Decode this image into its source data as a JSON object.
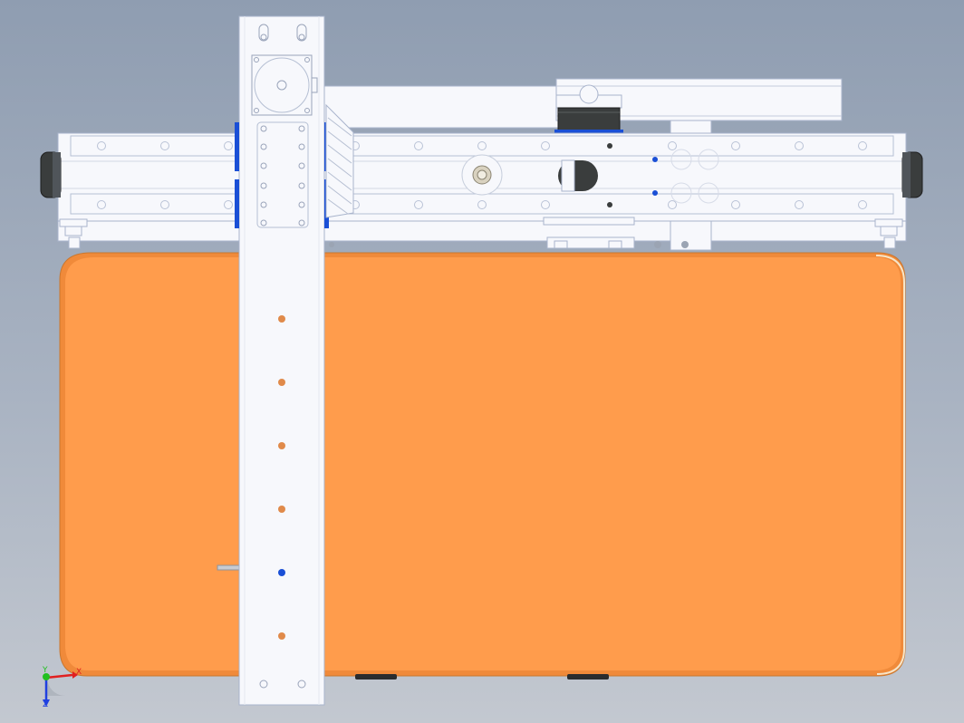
{
  "viewport": {
    "background_top": "#8f9db1",
    "background_bottom": "#c3c8d0"
  },
  "model": {
    "plate_color": "#ff9c4c",
    "plate_edge_color": "#e0842f",
    "frame_color": "#f7f8fc",
    "line_color": "#a9b4cc",
    "motor_color": "#3a3d3d",
    "highlight_blue": "#1a4fd6",
    "hole_color": "#e08a4a"
  },
  "triad": {
    "x_label": "X",
    "y_label": "Y",
    "z_label": "Z",
    "x_color": "#e02020",
    "y_color": "#20c020",
    "z_color": "#2040e0"
  }
}
